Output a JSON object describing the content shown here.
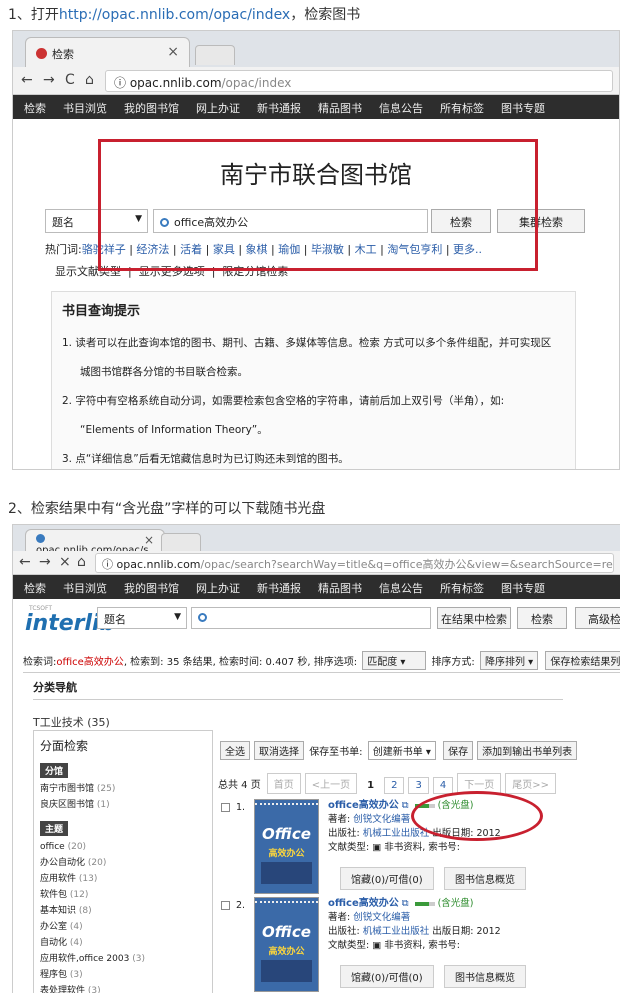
{
  "step1": {
    "prefix": "1、打开",
    "url": "http://opac.nnlib.com/opac/index",
    "suffix": "，检索图书"
  },
  "step2": {
    "text": "2、检索结果中有“含光盘”字样的可以下载随书光盘"
  },
  "shot1": {
    "tab_title": "检索",
    "tab_close": "×",
    "nav": {
      "back": "←",
      "forward": "→",
      "reload": "C",
      "home": "⌂"
    },
    "url_icon": "ⓘ",
    "url_host": "opac.nnlib.com",
    "url_path": "/opac/index",
    "menu": [
      "检索",
      "书目浏览",
      "我的图书馆",
      "网上办证",
      "新书通报",
      "精品图书",
      "信息公告",
      "所有标签",
      "图书专题"
    ],
    "title": "南宁市联合图书馆",
    "search_type": "题名",
    "search_arrow": "▼",
    "query": "office高效办公",
    "search_btn": "检索",
    "cluster_btn": "集群检索",
    "hot_label": "热门词:",
    "hot_words": [
      "骆驼祥子",
      "经济法",
      "活着",
      "家具",
      "象棋",
      "瑜伽",
      "毕淑敏",
      "木工",
      "淘气包亨利",
      "更多.."
    ],
    "options": [
      "显示文献类型",
      "显示更多选项",
      "限定分馆检索"
    ],
    "tips_title": "书目查询提示",
    "tips": [
      "1. 读者可以在此查询本馆的图书、期刊、古籍、多媒体等信息。检索 方式可以多个条件组配，并可实现区",
      "城图书馆群各分馆的书目联合检索。",
      "2. 字符中有空格系统自动分词，如需要检索包含空格的字符串，请前后加上双引号（半角），如:",
      "“Elements of Information Theory”。",
      "3. 点“详细信息”后看无馆藏信息时为已订购还未到馆的图书。"
    ]
  },
  "shot2": {
    "tab_title": "opac.nnlib.com/opac/s",
    "tab_close": "×",
    "nav": {
      "back": "←",
      "forward": "→",
      "stop": "×",
      "home": "⌂"
    },
    "url_icon": "ⓘ",
    "url_host": "opac.nnlib.com",
    "url_path": "/opac/search?searchWay=title&q=office高效办公&view=&searchSource=reader&booktype=",
    "menu": [
      "检索",
      "书目浏览",
      "我的图书馆",
      "网上办证",
      "新书通报",
      "精品图书",
      "信息公告",
      "所有标签",
      "图书专题"
    ],
    "logo_small": "TCSOFT",
    "logo": "interlib",
    "search_type": "题名",
    "search_arrow": "▼",
    "btn_in_result": "在结果中检索",
    "btn_search": "检索",
    "btn_adv": "高级检",
    "result_prefix": "检索词:",
    "result_term": "office高效办公",
    "result_mid": ", 检索到: 35 条结果, 检索时间: 0.407 秒, 排序选项:",
    "sort_opt": "匹配度",
    "sort_label": "排序方式:",
    "sort_dir": "降序排列",
    "save_list": "保存检索结果列表",
    "catnav_title": "分类导航",
    "catnav_item": "T工业技术 (35)",
    "facet_title": "分面检索",
    "facet_branch_tag": "分馆",
    "branches": [
      {
        "n": "南宁市图书馆",
        "c": "(25)"
      },
      {
        "n": "良庆区图书馆",
        "c": "(1)"
      }
    ],
    "facet_topic_tag": "主题",
    "topics": [
      {
        "n": "office",
        "c": "(20)"
      },
      {
        "n": "办公自动化",
        "c": "(20)"
      },
      {
        "n": "应用软件",
        "c": "(13)"
      },
      {
        "n": "软件包",
        "c": "(12)"
      },
      {
        "n": "基本知识",
        "c": "(8)"
      },
      {
        "n": "办公室",
        "c": "(4)"
      },
      {
        "n": "自动化",
        "c": "(4)"
      },
      {
        "n": "应用软件,office 2003",
        "c": "(3)"
      },
      {
        "n": "程序包",
        "c": "(3)"
      },
      {
        "n": "表处理软件",
        "c": "(3)"
      }
    ],
    "toolbar": {
      "select_all": "全选",
      "deselect": "取消选择",
      "save_to": "保存至书单:",
      "new_list": "创建新书单",
      "save": "保存",
      "add_export": "添加到输出书单列表"
    },
    "pager": {
      "total": "总共 4 页",
      "first": "首页",
      "prev": "<上一页",
      "p1": "1",
      "p2": "2",
      "p3": "3",
      "p4": "4",
      "next": "下一页",
      "last": "尾页>>"
    },
    "records": [
      {
        "no": "1.",
        "title": "office高效办公",
        "author_label": "著者:",
        "author": "创锐文化编著",
        "pub_label": "出版社:",
        "pub": "机械工业出版社",
        "date": "出版日期: 2012",
        "type_label": "文献类型:",
        "type": "非书资料, 索书号:",
        "cd": "(含光盘)",
        "holdings": "馆藏(0)/可借(0)",
        "overview": "图书信息概览"
      },
      {
        "no": "2.",
        "title": "office高效办公",
        "author_label": "著者:",
        "author": "创锐文化编著",
        "pub_label": "出版社:",
        "pub": "机械工业出版社",
        "date": "出版日期: 2012",
        "type_label": "文献类型:",
        "type": "非书资料, 索书号:",
        "cd": "(含光盘)",
        "holdings": "馆藏(0)/可借(0)",
        "overview": "图书信息概览"
      }
    ],
    "cover_title": "Office",
    "cover_sub": "高效办公"
  }
}
